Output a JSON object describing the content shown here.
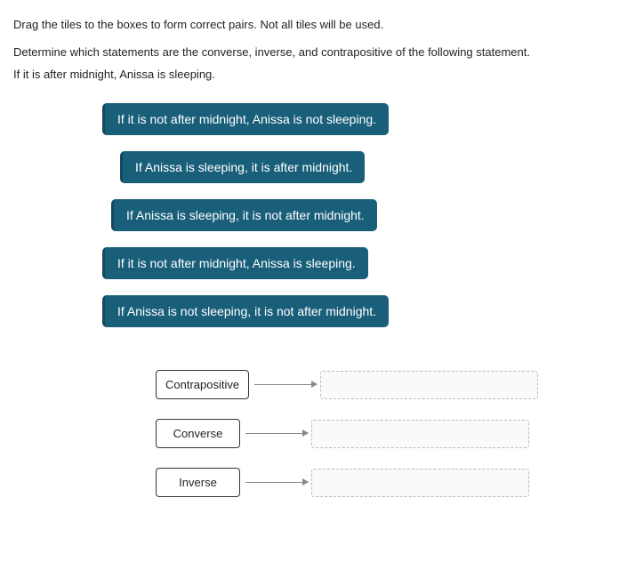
{
  "instructions": "Drag the tiles to the boxes to form correct pairs. Not all tiles will be used.",
  "question": "Determine which statements are the converse, inverse, and contrapositive of the following statement.",
  "premise": "If it is after midnight, Anissa is sleeping.",
  "tiles": [
    {
      "text": "If it is not after midnight, Anissa is not sleeping.",
      "indent": ""
    },
    {
      "text": "If Anissa is sleeping, it is after midnight.",
      "indent": "indent-1"
    },
    {
      "text": "If Anissa is sleeping, it is not after midnight.",
      "indent": "indent-2"
    },
    {
      "text": "If it is not after midnight, Anissa is sleeping.",
      "indent": ""
    },
    {
      "text": "If Anissa is not sleeping, it is not after midnight.",
      "indent": ""
    }
  ],
  "answers": [
    {
      "label": "Contrapositive"
    },
    {
      "label": "Converse"
    },
    {
      "label": "Inverse"
    }
  ]
}
